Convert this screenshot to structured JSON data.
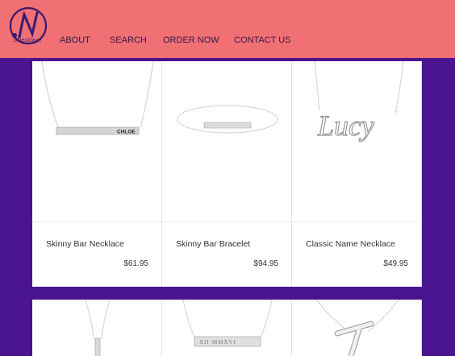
{
  "header": {
    "logo_text": "oNecklace",
    "nav": [
      "ABOUT",
      "SEARCH",
      "ORDER NOW",
      "CONTACT US"
    ]
  },
  "products": [
    {
      "name": "Skinny Bar Necklace",
      "price": "$61.95",
      "engraving": "CHLOE"
    },
    {
      "name": "Skinny Bar Bracelet",
      "price": "$94.95"
    },
    {
      "name": "Classic Name Necklace",
      "price": "$49.95",
      "engraving": "Lucy"
    },
    {
      "name": "",
      "price": ""
    },
    {
      "name": "",
      "price": "",
      "engraving": "XII·MMXVI"
    },
    {
      "name": "",
      "price": ""
    }
  ],
  "colors": {
    "header": "#f07073",
    "background": "#4a1490",
    "card": "#ffffff",
    "logo": "#3b1a6e"
  }
}
